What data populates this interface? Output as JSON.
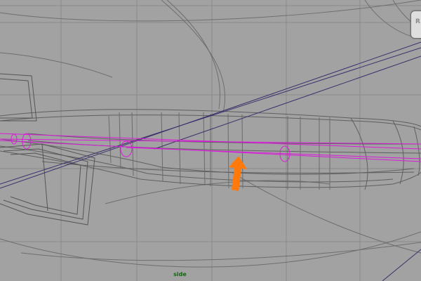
{
  "viewport": {
    "camera_label": "side",
    "view_cube_text": "RI"
  },
  "colors": {
    "background": "#a2a2a2",
    "grid": "#8a8a8a",
    "wireframe": "#5f5f5f",
    "selected_curves": "#d81bd8",
    "dark_lines": "#3b2f6b",
    "camera_label": "#0b6a0b",
    "annotation_arrow": "#ff7a0a"
  },
  "icons": {
    "view_cube": "view-cube",
    "annotation": "orange-up-arrow"
  }
}
